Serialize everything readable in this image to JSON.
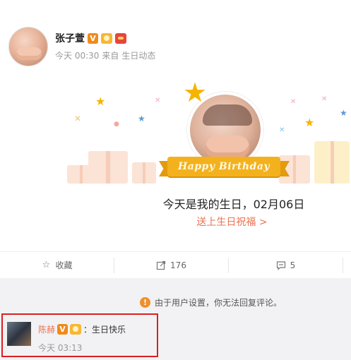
{
  "post": {
    "username": "张子萱",
    "badge_v": "V",
    "time": "今天 00:30",
    "source_prefix": "来自",
    "source": "生日动态"
  },
  "birthday": {
    "ribbon": "Happy Birthday",
    "message": "今天是我的生日，02月06日",
    "link": "送上生日祝福 >"
  },
  "actions": {
    "favorite_label": "收藏",
    "repost_count": "176",
    "comment_count": "5"
  },
  "comments": {
    "notice": "由于用户设置，你无法回复评论。",
    "items": [
      {
        "name": "陈赫",
        "badge_v": "V",
        "text": "：生日快乐",
        "time": "今天 03:13"
      }
    ]
  },
  "colors": {
    "accent": "#eb7350",
    "highlight_border": "#d9211f",
    "ribbon": "#f3b21d"
  }
}
